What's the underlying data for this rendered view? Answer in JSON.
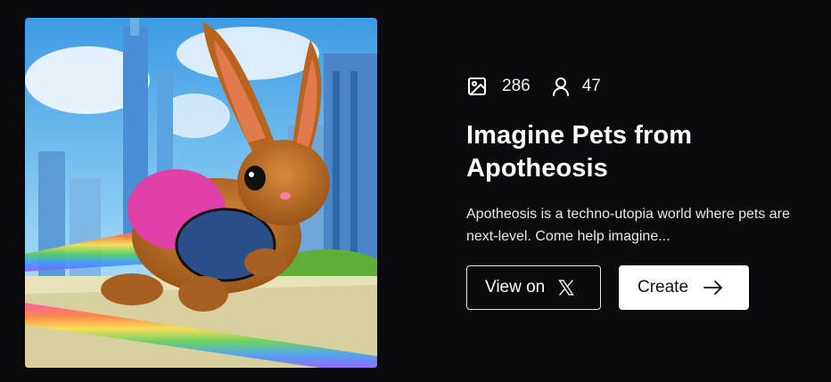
{
  "stats": {
    "images": "286",
    "members": "47"
  },
  "collection": {
    "title": "Imagine Pets from Apotheosis",
    "description": "Apotheosis is a techno-utopia world where pets are next-level. Come help imagine..."
  },
  "buttons": {
    "view_on_label": "View on",
    "create_label": "Create"
  },
  "icons": {
    "images": "image-icon",
    "members": "user-icon",
    "x_logo": "x-logo-icon",
    "arrow": "arrow-right-icon"
  },
  "colors": {
    "background": "#0b0a0c",
    "text": "#ffffff",
    "solid_button_bg": "#ffffff"
  }
}
